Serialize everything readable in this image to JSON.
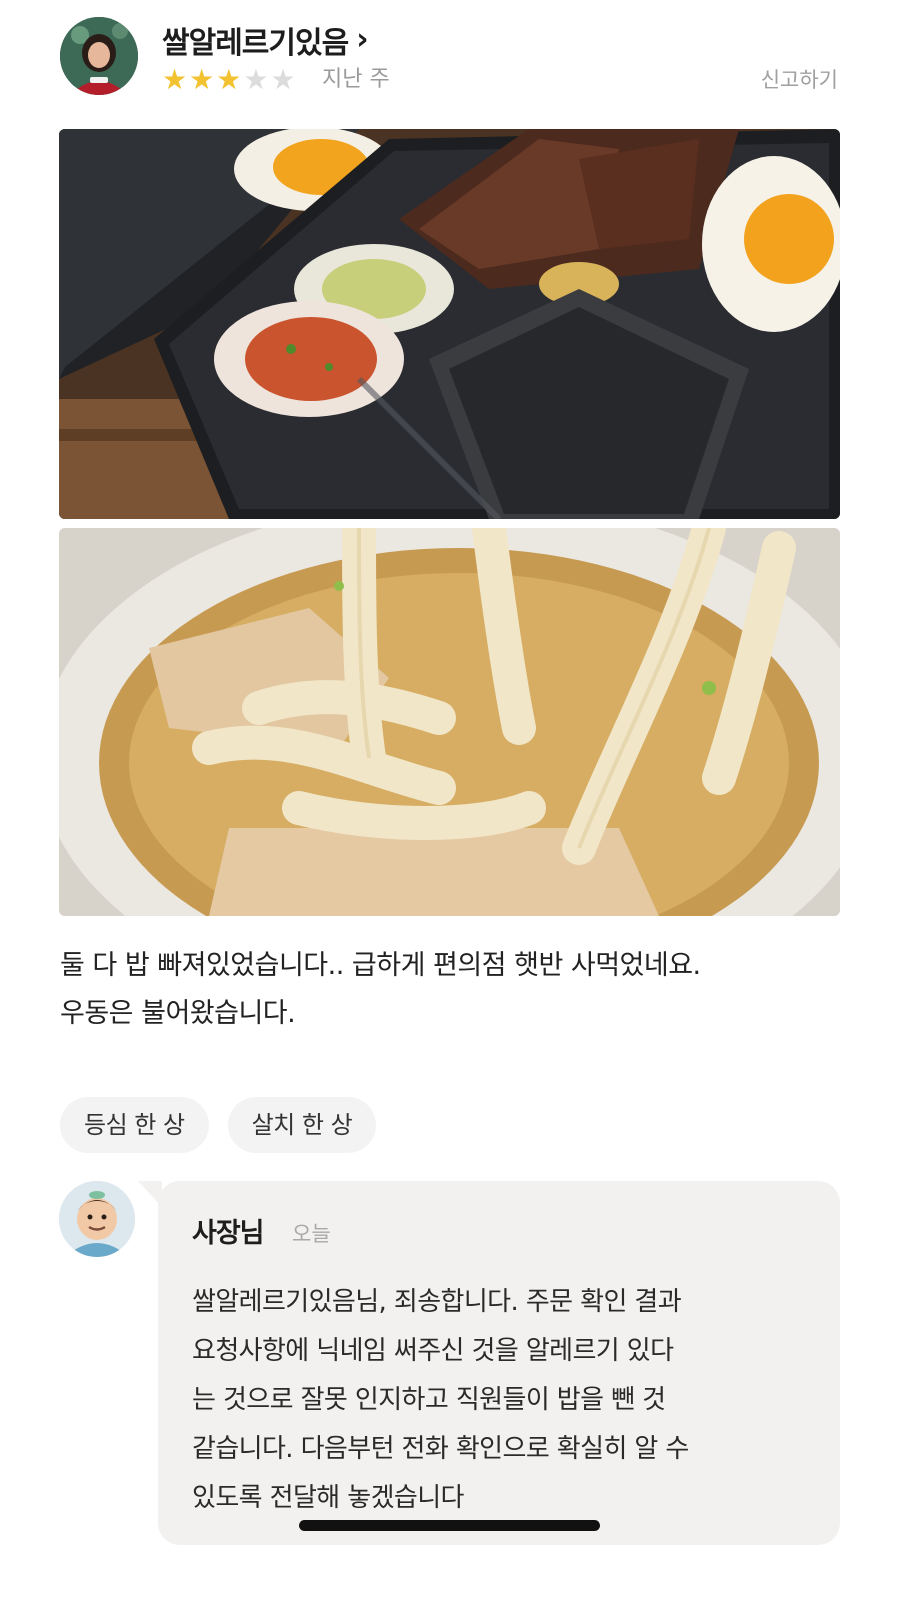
{
  "review": {
    "reviewer_name": "쌀알레르기있음",
    "chevron": "›",
    "rating": 3,
    "rating_max": 5,
    "star_glyph": "★",
    "date": "지난 주",
    "report_label": "신고하기",
    "photos": [
      {
        "subject": "steak-bento-photo"
      },
      {
        "subject": "udon-photo"
      }
    ],
    "text_lines": [
      "둘 다 밥 빠져있었습니다.. 급하게 편의점 햇반 사먹었네요.",
      "우동은 불어왔습니다."
    ],
    "menu_tags": [
      "등심 한 상",
      "살치 한 상"
    ]
  },
  "owner_reply": {
    "name": "사장님",
    "time": "오늘",
    "text_lines": [
      "쌀알레르기있음님, 죄송합니다. 주문 확인 결과",
      "요청사항에 닉네임 써주신 것을 알레르기 있다",
      "는 것으로 잘못 인지하고 직원들이 밥을 뺀 것",
      "같습니다. 다음부턴 전화 확인으로 확실히 알 수",
      "있도록 전달해 놓겠습니다"
    ]
  },
  "colors": {
    "star_on": "#f2c230",
    "star_off": "#dcdcdc",
    "reply_bg": "#f3f1ef",
    "tag_bg": "#f3f3f3"
  }
}
